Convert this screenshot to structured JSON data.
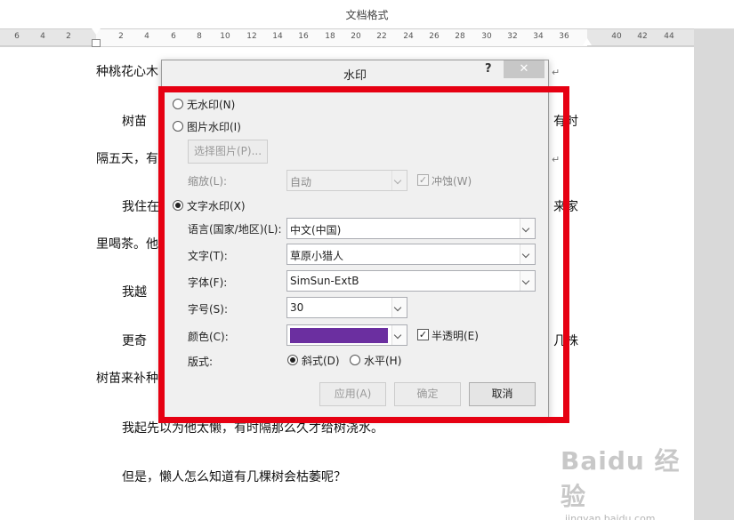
{
  "window": {
    "title": "文档格式"
  },
  "ruler": {
    "ticks": [
      "6",
      "4",
      "2",
      "2",
      "4",
      "6",
      "8",
      "10",
      "12",
      "14",
      "16",
      "18",
      "20",
      "22",
      "24",
      "26",
      "28",
      "30",
      "32",
      "34",
      "36",
      "40",
      "42",
      "44"
    ]
  },
  "document": {
    "lines": [
      "种桃花心木",
      "树苗",
      "有时",
      "隔五天，有",
      "我住在",
      "来家",
      "里喝茶。他",
      "我越",
      "更奇",
      "几株",
      "树苗来补种",
      "我起先以为他太懒，有时隔那么久才给树浇水。",
      "但是，懒人怎么知道有几棵树会枯萎呢？"
    ],
    "para_mark": "↵"
  },
  "dialog": {
    "title": "水印",
    "help": "?",
    "close": "✕",
    "no_watermark": "无水印(N)",
    "picture_watermark": "图片水印(I)",
    "select_picture_button": "选择图片(P)...",
    "scale_label": "缩放(L):",
    "scale_value": "自动",
    "washout_label": "冲蚀(W)",
    "washout_check": "✓",
    "text_watermark": "文字水印(X)",
    "language_label": "语言(国家/地区)(L):",
    "language_value": "中文(中国)",
    "text_label": "文字(T):",
    "text_value": "草原小猎人",
    "font_label": "字体(F):",
    "font_value": "SimSun-ExtB",
    "size_label": "字号(S):",
    "size_value": "30",
    "color_label": "颜色(C):",
    "color_value": "#6b2fa0",
    "semitransparent_label": "半透明(E)",
    "semitransparent_check": "✓",
    "layout_label": "版式:",
    "diagonal_label": "斜式(D)",
    "horizontal_label": "水平(H)",
    "apply_button": "应用(A)",
    "ok_button": "确定",
    "cancel_button": "取消"
  },
  "watermark": {
    "logo": "Baidu 经验",
    "url": "jingyan.baidu.com"
  },
  "colors": {
    "highlight": "#e60012",
    "selected_color": "#6b2fa0"
  }
}
